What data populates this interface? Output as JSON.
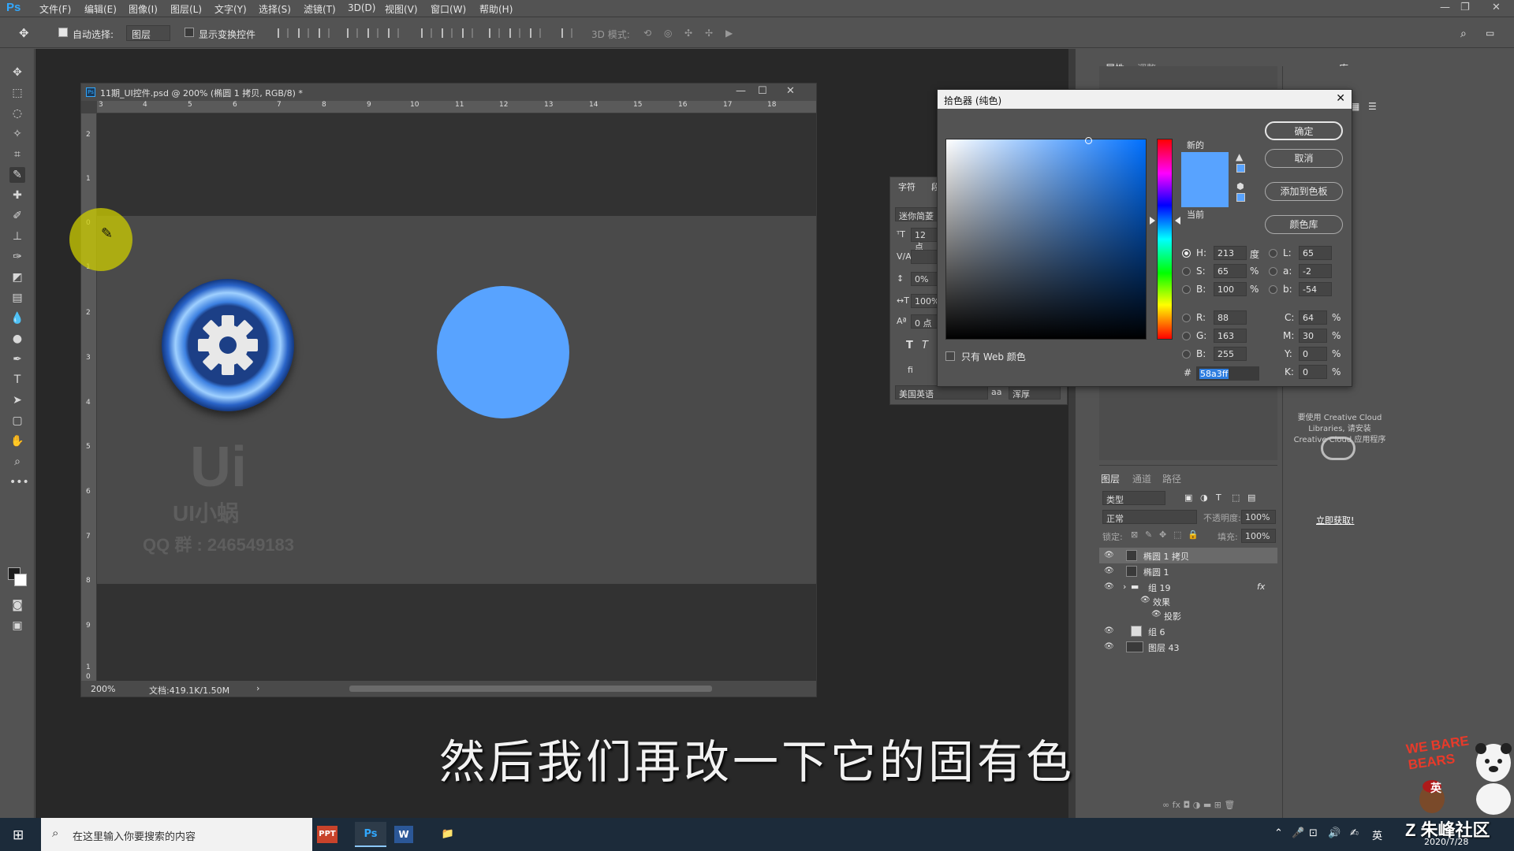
{
  "app": {
    "logo": "Ps",
    "menu": [
      "文件(F)",
      "编辑(E)",
      "图像(I)",
      "图层(L)",
      "文字(Y)",
      "选择(S)",
      "滤镜(T)",
      "3D(D)",
      "视图(V)",
      "窗口(W)",
      "帮助(H)"
    ],
    "window_controls": [
      "—",
      "❐",
      "✕"
    ]
  },
  "options_bar": {
    "auto_select_label": "自动选择:",
    "auto_select_value": "图层",
    "show_transform_label": "显示变换控件",
    "mode_3d_label": "3D 模式:"
  },
  "document": {
    "title": "11期_UI控件.psd @ 200% (椭圆 1 拷贝, RGB/8) *",
    "title_icon": "Ps",
    "ruler_h": [
      "3",
      "4",
      "5",
      "6",
      "7",
      "8",
      "9",
      "10",
      "11",
      "12",
      "13",
      "14",
      "15",
      "16",
      "17",
      "18"
    ],
    "ruler_v": [
      "2",
      "1",
      "0",
      "1",
      "2",
      "3",
      "4",
      "5",
      "6",
      "7",
      "8",
      "9",
      "1",
      "0"
    ],
    "zoom": "200%",
    "doc_info": "文档:419.1K/1.50M",
    "watermark_logo": "Ui",
    "watermark_name": "UI小蜗",
    "watermark_qq": "QQ 群 :   246549183"
  },
  "char_panel": {
    "tabs": [
      "字符",
      "段"
    ],
    "font_family": "迷你简菱",
    "font_size": "12 点",
    "tracking_label": "V/A",
    "vertical_scale": "0%",
    "horizontal_scale": "100%",
    "baseline": "0 点",
    "language": "美国英语",
    "aa_label": "aa",
    "aa_method": "浑厚"
  },
  "color_picker": {
    "title": "拾色器 (纯色)",
    "new_label": "新的",
    "current_label": "当前",
    "buttons": {
      "ok": "确定",
      "cancel": "取消",
      "add_swatch": "添加到色板",
      "libraries": "颜色库"
    },
    "web_only_label": "只有 Web 颜色",
    "hsb": {
      "H": "213",
      "H_unit": "度",
      "S": "65",
      "S_unit": "%",
      "B": "100",
      "B_unit": "%"
    },
    "rgb": {
      "R": "88",
      "G": "163",
      "B": "255"
    },
    "lab": {
      "L": "65",
      "a": "-2",
      "b": "-54"
    },
    "cmyk": {
      "C": "64",
      "M": "30",
      "Y": "0",
      "K": "0",
      "unit": "%"
    },
    "hex_label": "#",
    "hex": "58a3ff",
    "color": "#58a3ff"
  },
  "right_panels": {
    "top_tabs": [
      "属性",
      "调整"
    ],
    "lib_tab": "库",
    "lib_message": "要使用 Creative Cloud Libraries, 请安装 Creative Cloud 应用程序",
    "lib_link": "立即获取!",
    "layer_tabs": [
      "图层",
      "通道",
      "路径"
    ],
    "filter_type": "类型",
    "blend_mode": "正常",
    "opacity_label": "不透明度:",
    "opacity": "100%",
    "lock_label": "锁定:",
    "fill_label": "填充:",
    "fill": "100%",
    "layers": [
      {
        "name": "椭圆 1 拷贝",
        "selected": true
      },
      {
        "name": "椭圆 1",
        "selected": false
      },
      {
        "name": "组 19",
        "selected": false,
        "fx": "fx"
      },
      {
        "name": "效果",
        "selected": false
      },
      {
        "name": "投影",
        "selected": false
      },
      {
        "name": "组 6",
        "selected": false
      },
      {
        "name": "图层 43",
        "selected": false
      }
    ]
  },
  "caption": "然后我们再改一下它的固有色",
  "taskbar": {
    "search_placeholder": "在这里输入你要搜索的内容",
    "apps": [
      "PPT",
      "Ps",
      "W",
      "📁"
    ],
    "tray_lang": "英",
    "brand": "Z 朱峰社区",
    "date": "2020/7/28",
    "sticker": "WE BARE BEARS",
    "sticker_text": "英"
  }
}
